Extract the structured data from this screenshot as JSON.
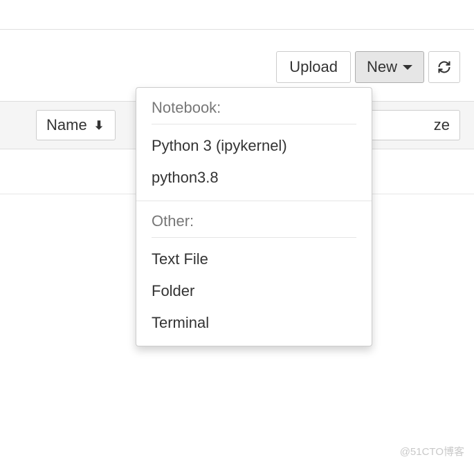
{
  "toolbar": {
    "upload_label": "Upload",
    "new_label": "New",
    "refresh_icon": "refresh-icon"
  },
  "header": {
    "name_label": "Name",
    "filesize_label_visible_fragment": "ze"
  },
  "dropdown": {
    "section1_header": "Notebook:",
    "section1_items": [
      "Python 3 (ipykernel)",
      "python3.8"
    ],
    "section2_header": "Other:",
    "section2_items": [
      "Text File",
      "Folder",
      "Terminal"
    ]
  },
  "watermark": "@51CTO博客"
}
